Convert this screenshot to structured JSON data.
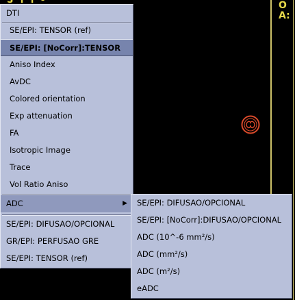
{
  "viewer": {
    "top_fragment": "S  l  l  -",
    "right_line1": "O",
    "right_line2": "A:"
  },
  "menu": {
    "header": "DTI",
    "items": [
      "SE/EPI: TENSOR (ref)",
      "SE/EPI: [NoCorr]:TENSOR",
      "Aniso Index",
      "AvDC",
      "Colored orientation",
      "Exp attenuation",
      "FA",
      "Isotropic Image",
      "Trace",
      "Vol Ratio Aniso"
    ],
    "submenu_label": "ADC",
    "bottom_items": [
      "SE/EPI: DIFUSAO/OPCIONAL",
      "GR/EPI: PERFUSAO GRE",
      "SE/EPI: TENSOR (ref)"
    ]
  },
  "submenu": {
    "items": [
      "SE/EPI: DIFUSAO/OPCIONAL",
      "SE/EPI: [NoCorr]:DIFUSAO/OPCIONAL",
      "ADC (10^-6 mm²/s)",
      "ADC (mm²/s)",
      "ADC (m²/s)",
      "eADC"
    ]
  },
  "colors": {
    "menu_bg": "#b8c0da",
    "highlight": "#7784ad",
    "overlay_text": "#e6d84a",
    "logo": "#d94a2a"
  },
  "icons": [
    "ge-logo-icon",
    "submenu-arrow-icon"
  ]
}
